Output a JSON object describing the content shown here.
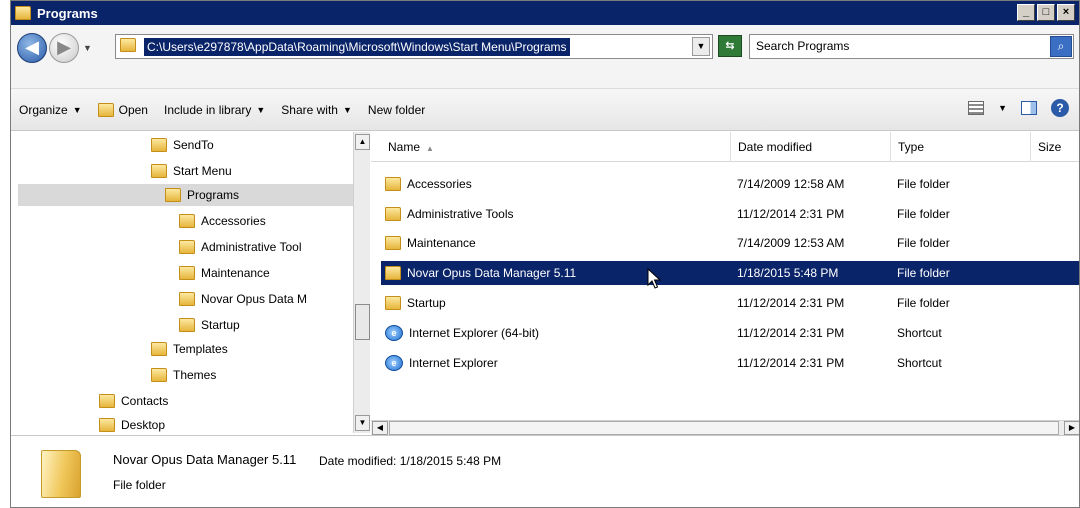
{
  "window": {
    "title": "Programs",
    "controls": [
      "_",
      "□",
      "×"
    ]
  },
  "address": {
    "path": "C:\\Users\\e297878\\AppData\\Roaming\\Microsoft\\Windows\\Start Menu\\Programs",
    "search_placeholder": "Search Programs"
  },
  "toolbar": {
    "organize": "Organize",
    "open": "Open",
    "include_in_library": "Include in library",
    "share_with": "Share with",
    "new_folder": "New folder"
  },
  "tree": [
    {
      "label": "SendTo"
    },
    {
      "label": "Start Menu"
    },
    {
      "label": "Programs",
      "selected": true
    },
    {
      "label": "Accessories"
    },
    {
      "label": "Administrative Tool"
    },
    {
      "label": "Maintenance"
    },
    {
      "label": "Novar Opus Data M"
    },
    {
      "label": "Startup"
    },
    {
      "label": "Templates"
    },
    {
      "label": "Themes"
    },
    {
      "label": "Contacts"
    },
    {
      "label": "Desktop"
    }
  ],
  "columns": {
    "name": "Name",
    "date": "Date modified",
    "type": "Type",
    "size": "Size"
  },
  "files": [
    {
      "name": "Accessories",
      "date": "7/14/2009 12:58 AM",
      "type": "File folder",
      "icon": "folder"
    },
    {
      "name": "Administrative Tools",
      "date": "11/12/2014 2:31 PM",
      "type": "File folder",
      "icon": "folder"
    },
    {
      "name": "Maintenance",
      "date": "7/14/2009 12:53 AM",
      "type": "File folder",
      "icon": "folder"
    },
    {
      "name": "Novar Opus Data Manager 5.11",
      "date": "1/18/2015 5:48 PM",
      "type": "File folder",
      "icon": "folder",
      "selected": true
    },
    {
      "name": "Startup",
      "date": "11/12/2014 2:31 PM",
      "type": "File folder",
      "icon": "folder"
    },
    {
      "name": "Internet Explorer (64-bit)",
      "date": "11/12/2014 2:31 PM",
      "type": "Shortcut",
      "icon": "ie-shortcut"
    },
    {
      "name": "Internet Explorer",
      "date": "11/12/2014 2:31 PM",
      "type": "Shortcut",
      "icon": "ie-shortcut"
    }
  ],
  "details": {
    "name": "Novar Opus Data Manager 5.11",
    "modified": "Date modified: 1/18/2015 5:48 PM",
    "type": "File folder"
  },
  "colors": {
    "selection": "#0a246a",
    "title_bar": "#0a246a"
  }
}
